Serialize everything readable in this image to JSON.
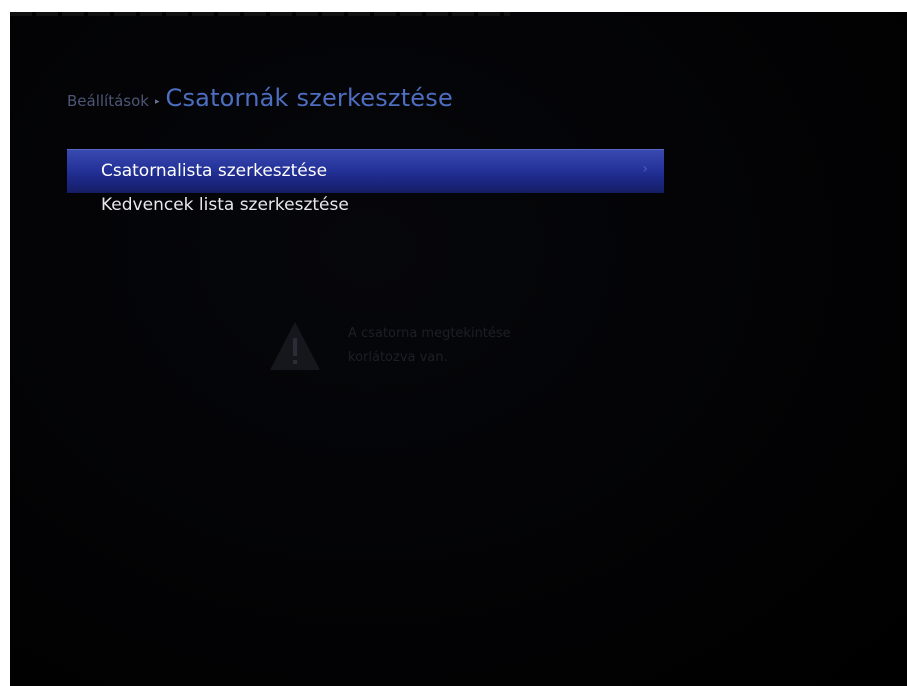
{
  "breadcrumb": {
    "parent": "Beállítások",
    "separator": "▸",
    "title": "Csatornák szerkesztése"
  },
  "menu": {
    "items": [
      {
        "label": "Csatornalista szerkesztése",
        "selected": true,
        "chevron": "›"
      },
      {
        "label": "Kedvencek lista szerkesztése",
        "selected": false
      }
    ]
  },
  "warning": {
    "icon": "warning-icon",
    "line1": "A csatorna megtekintése",
    "line2": "korlátozva van."
  },
  "colors": {
    "background": "#030305",
    "selection": "#25339a",
    "title_accent": "#4d6ec0"
  }
}
